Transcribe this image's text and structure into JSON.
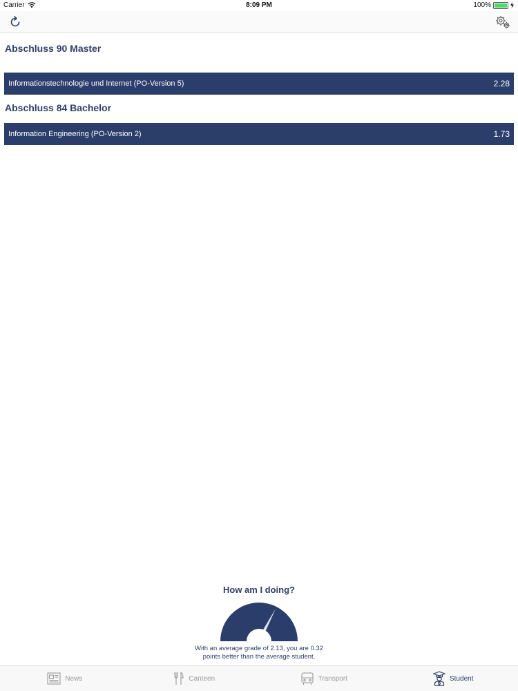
{
  "status_bar": {
    "carrier": "Carrier",
    "time": "8:09 PM",
    "battery": "100%",
    "battery_level": 1.0
  },
  "nav": {
    "refresh_icon": "refresh-icon",
    "settings_icon": "gear-icon"
  },
  "sections": [
    {
      "title": "Abschluss 90 Master",
      "degrees": [
        {
          "name": "Informationstechnologie und Internet  (PO-Version 5)",
          "grade": "2.28"
        }
      ]
    },
    {
      "title": "Abschluss 84 Bachelor",
      "degrees": [
        {
          "name": "Information Engineering  (PO-Version 2)",
          "grade": "1.73"
        }
      ]
    }
  ],
  "performance": {
    "title": "How am I doing?",
    "line1": "With an average grade of 2.13, you are 0.32",
    "line2": "points better than the average student.",
    "gauge_color": "#2b3e6b"
  },
  "tabs": [
    {
      "label": "News",
      "icon": "newspaper-icon",
      "active": false
    },
    {
      "label": "Canteen",
      "icon": "cutlery-icon",
      "active": false
    },
    {
      "label": "Transport",
      "icon": "bus-icon",
      "active": false
    },
    {
      "label": "Student",
      "icon": "student-icon",
      "active": true
    }
  ],
  "colors": {
    "accent": "#2b3e6b",
    "inactive": "#9a9a9a"
  }
}
